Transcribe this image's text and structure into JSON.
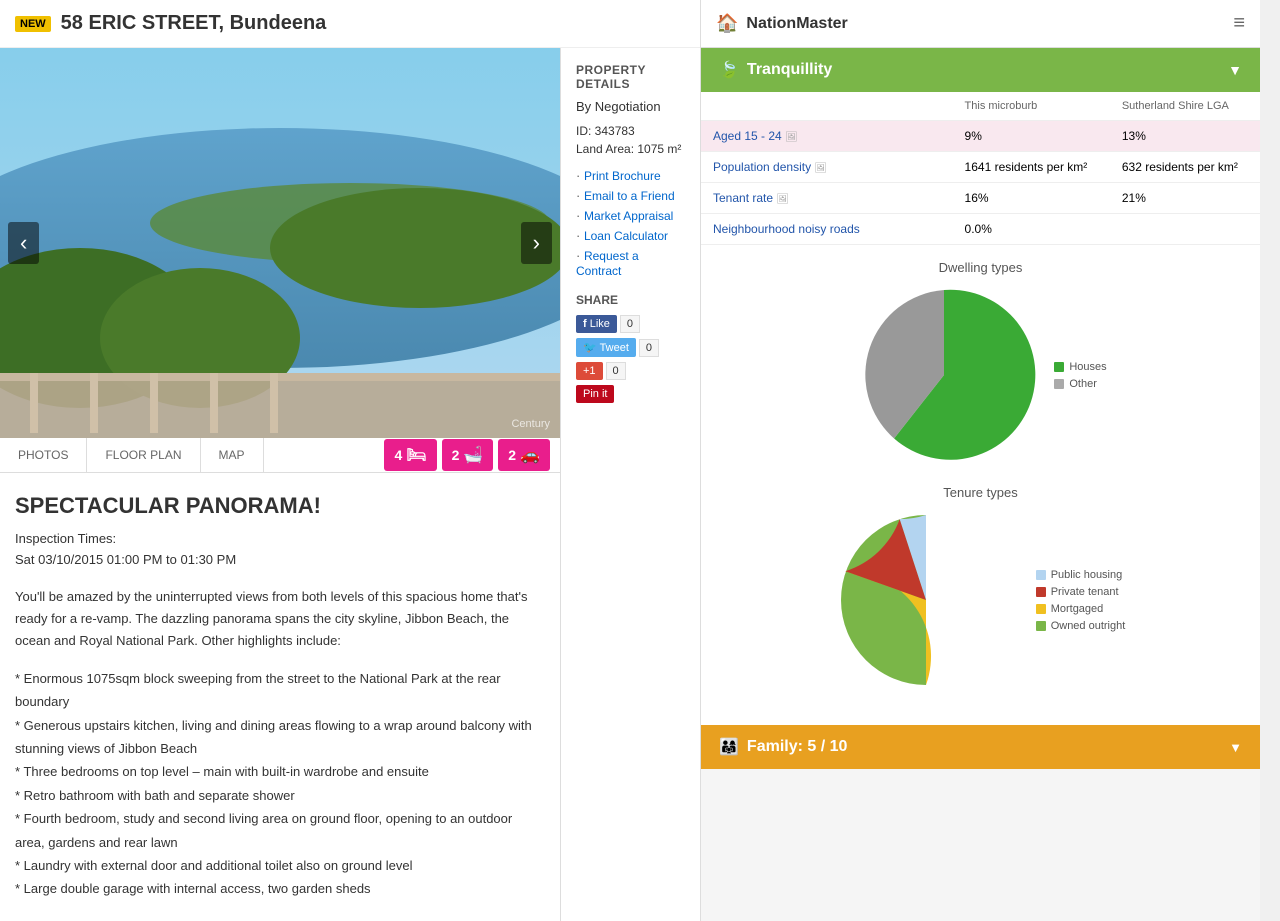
{
  "property": {
    "badge": "NEW",
    "title": "58 ERIC STREET, Bundeena",
    "price": "By Negotiation",
    "id_label": "ID: 343783",
    "land_area": "Land Area: 1075 m²",
    "headline": "SPECTACULAR PANORAMA!",
    "inspection_label": "Inspection Times:",
    "inspection_time": "Sat 03/10/2015 01:00 PM to 01:30 PM",
    "description": "You'll be amazed by the uninterrupted views from both levels of this spacious home that's ready for a re-vamp. The dazzling panorama spans the city skyline, Jibbon Beach, the ocean and Royal National Park. Other highlights include:",
    "bullets": [
      "Enormous 1075sqm block sweeping from the street to the National Park at the rear boundary",
      "Generous upstairs kitchen, living and dining areas flowing to a wrap around balcony with stunning views of Jibbon Beach",
      "Three bedrooms on top level – main with built-in wardrobe and ensuite",
      "Retro bathroom with bath and separate shower",
      "Fourth bedroom, study and second living area on ground floor, opening to an outdoor area, gardens and rear lawn",
      "Laundry with external door and additional toilet also on ground level",
      "Large double garage with internal access, two garden sheds"
    ],
    "image_credit": "Century",
    "tabs": [
      "PHOTOS",
      "FLOOR PLAN",
      "MAP"
    ],
    "beds": "4",
    "baths": "2",
    "cars": "2",
    "links": [
      "Print Brochure",
      "Email to a Friend",
      "Market Appraisal",
      "Loan Calculator",
      "Request a Contract"
    ],
    "share_label": "SHARE",
    "property_details_label": "PROPERTY DETAILS"
  },
  "social": {
    "fb_label": "Like",
    "fb_count": "0",
    "tw_label": "Tweet",
    "tw_count": "0",
    "gp_label": "+1",
    "gp_count": "0",
    "pin_label": "Pin it"
  },
  "nation_master": {
    "title": "NationMaster",
    "menu_icon": "≡",
    "tranquility_label": "Tranquillity",
    "col_microburb": "This microburb",
    "col_lga": "Sutherland Shire LGA",
    "stats": [
      {
        "metric": "Aged 15 - 24",
        "microburb": "9%",
        "lga": "13%",
        "highlight": true,
        "has_info": true
      },
      {
        "metric": "Population density",
        "microburb": "1641 residents per km²",
        "lga": "632 residents per km²",
        "highlight": false,
        "has_info": true
      },
      {
        "metric": "Tenant rate",
        "microburb": "16%",
        "lga": "21%",
        "highlight": false,
        "has_info": true
      },
      {
        "metric": "Neighbourhood noisy roads",
        "microburb": "0.0%",
        "lga": "",
        "highlight": false,
        "has_info": false
      }
    ],
    "dwelling_chart_title": "Dwelling types",
    "dwelling_legend": [
      {
        "label": "Houses",
        "color": "#3aaa35"
      },
      {
        "label": "Other",
        "color": "#aaaaaa"
      }
    ],
    "tenure_chart_title": "Tenure types",
    "tenure_legend": [
      {
        "label": "Public housing",
        "color": "#b3d4f0"
      },
      {
        "label": "Private tenant",
        "color": "#c0392b"
      },
      {
        "label": "Mortgaged",
        "color": "#f0c020"
      },
      {
        "label": "Owned outright",
        "color": "#7ab648"
      }
    ],
    "family_label": "Family: 5 / 10"
  }
}
